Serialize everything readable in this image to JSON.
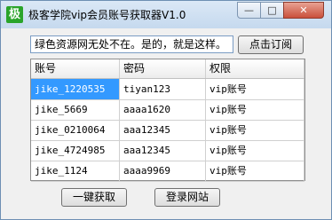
{
  "window": {
    "icon_glyph": "极",
    "title": "极客学院vip会员账号获取器V1.0",
    "min_glyph": "—",
    "max_glyph": "□",
    "close_glyph": "✕"
  },
  "announcement": "绿色资源网无处不在。是的，就是这样。",
  "subscribe_label": "点击订阅",
  "table": {
    "columns": [
      "账号",
      "密码",
      "权限"
    ],
    "rows": [
      [
        "jike_1220535",
        "tiyan123",
        "vip账号"
      ],
      [
        "jike_5669",
        "aaaa1620",
        "vip账号"
      ],
      [
        "jike_0210064",
        "aaa12345",
        "vip账号"
      ],
      [
        "jike_4724985",
        "aaa12345",
        "vip账号"
      ],
      [
        "jike_1124",
        "aaaa9969",
        "vip账号"
      ]
    ]
  },
  "get_label": "一键获取",
  "login_label": "登录网站",
  "colors": {
    "selection": "#3399ff",
    "icon_green": "#2aa42a"
  }
}
